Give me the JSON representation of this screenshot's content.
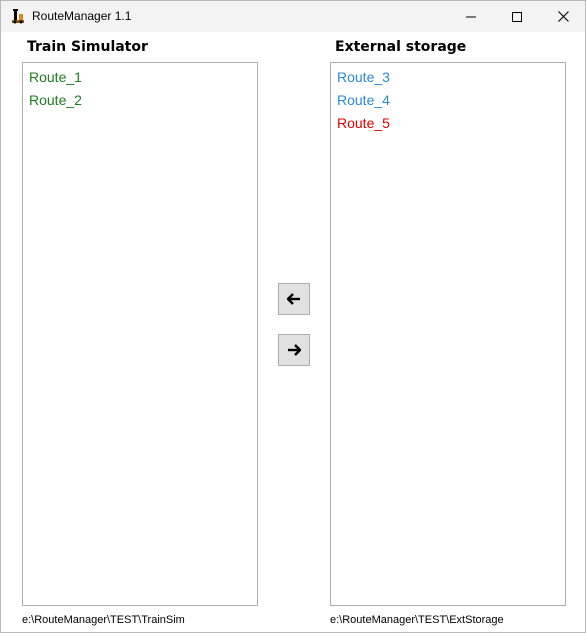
{
  "window": {
    "title": "RouteManager 1.1",
    "app_icon": "train-simulator-logo-icon"
  },
  "left_panel": {
    "title": "Train Simulator",
    "items": [
      {
        "label": "Route_1",
        "color": "#1e7d1e"
      },
      {
        "label": "Route_2",
        "color": "#1e7d1e"
      }
    ],
    "path": "e:\\RouteManager\\TEST\\TrainSim"
  },
  "right_panel": {
    "title": "External storage",
    "items": [
      {
        "label": "Route_3",
        "color": "#2b88d8"
      },
      {
        "label": "Route_4",
        "color": "#2b88d8"
      },
      {
        "label": "Route_5",
        "color": "#e00000"
      }
    ],
    "path": "e:\\RouteManager\\TEST\\ExtStorage"
  },
  "buttons": {
    "move_left_icon": "arrow-left-icon",
    "move_right_icon": "arrow-right-icon"
  }
}
